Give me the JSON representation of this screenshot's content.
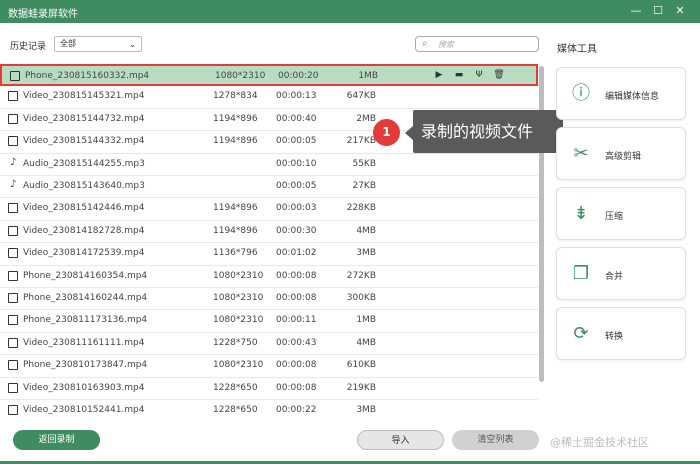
{
  "window": {
    "title": "数据蛙录屏软件"
  },
  "titlebar": {
    "min": "—",
    "max": "☐",
    "close": "✕"
  },
  "filter": {
    "label": "历史记录",
    "selected": "全部"
  },
  "search": {
    "placeholder": "搜索"
  },
  "files": [
    {
      "name": "Phone_230815160332.mp4",
      "res": "1080*2310",
      "dur": "00:00:20",
      "size": "1MB",
      "type": "video"
    },
    {
      "name": "Video_230815145321.mp4",
      "res": "1278*834",
      "dur": "00:00:13",
      "size": "647KB",
      "type": "video"
    },
    {
      "name": "Video_230815144732.mp4",
      "res": "1194*896",
      "dur": "00:00:40",
      "size": "2MB",
      "type": "video"
    },
    {
      "name": "Video_230815144332.mp4",
      "res": "1194*896",
      "dur": "00:00:05",
      "size": "217KB",
      "type": "video"
    },
    {
      "name": "Audio_230815144255.mp3",
      "res": "",
      "dur": "00:00:10",
      "size": "55KB",
      "type": "audio"
    },
    {
      "name": "Audio_230815143640.mp3",
      "res": "",
      "dur": "00:00:05",
      "size": "27KB",
      "type": "audio"
    },
    {
      "name": "Video_230815142446.mp4",
      "res": "1194*896",
      "dur": "00:00:03",
      "size": "228KB",
      "type": "video"
    },
    {
      "name": "Video_230814182728.mp4",
      "res": "1194*896",
      "dur": "00:00:30",
      "size": "4MB",
      "type": "video"
    },
    {
      "name": "Video_230814172539.mp4",
      "res": "1136*796",
      "dur": "00:01:02",
      "size": "3MB",
      "type": "video"
    },
    {
      "name": "Phone_230814160354.mp4",
      "res": "1080*2310",
      "dur": "00:00:08",
      "size": "272KB",
      "type": "video"
    },
    {
      "name": "Phone_230814160244.mp4",
      "res": "1080*2310",
      "dur": "00:00:08",
      "size": "300KB",
      "type": "video"
    },
    {
      "name": "Phone_230811173136.mp4",
      "res": "1080*2310",
      "dur": "00:00:11",
      "size": "1MB",
      "type": "video"
    },
    {
      "name": "Video_230811161111.mp4",
      "res": "1228*750",
      "dur": "00:00:43",
      "size": "4MB",
      "type": "video"
    },
    {
      "name": "Phone_230810173847.mp4",
      "res": "1080*2310",
      "dur": "00:00:08",
      "size": "610KB",
      "type": "video"
    },
    {
      "name": "Video_230810163903.mp4",
      "res": "1228*650",
      "dur": "00:00:08",
      "size": "219KB",
      "type": "video"
    },
    {
      "name": "Video_230810152441.mp4",
      "res": "1228*650",
      "dur": "00:00:22",
      "size": "3MB",
      "type": "video"
    }
  ],
  "callout": {
    "number": "1",
    "text": "录制的视频文件"
  },
  "sidebar": {
    "title": "媒体工具",
    "tools": [
      {
        "label": "编辑媒体信息",
        "icon": "ⓘ"
      },
      {
        "label": "高级剪辑",
        "icon": "✂"
      },
      {
        "label": "压缩",
        "icon": "⇟"
      },
      {
        "label": "合并",
        "icon": "❐"
      },
      {
        "label": "转换",
        "icon": "⟳"
      }
    ]
  },
  "footer": {
    "back": "返回录制",
    "import": "导入",
    "clear": "清空列表"
  },
  "watermark": "@稀土掘金技术社区",
  "colors": {
    "accent": "#3e8c5f",
    "highlight": "#e33a3a",
    "selected_row": "#b8dcc2"
  }
}
